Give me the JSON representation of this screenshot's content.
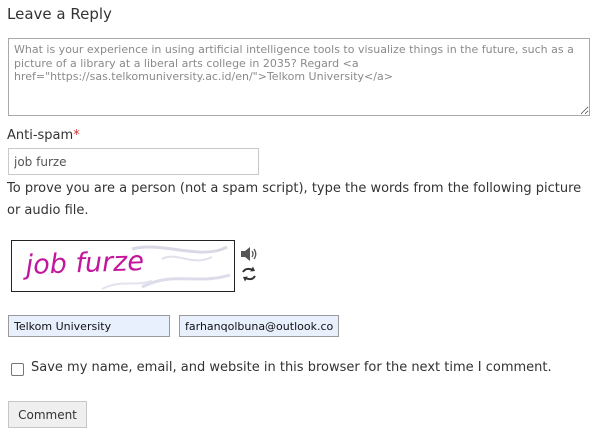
{
  "reply": {
    "title": "Leave a Reply"
  },
  "comment": {
    "placeholder": "What is your experience in using artificial intelligence tools to visualize things in the future, such as a picture of a library at a liberal arts college in 2035? Regard <a href=\"https://sas.telkomuniversity.ac.id/en/\">Telkom University</a>"
  },
  "antispam": {
    "label": "Anti-spam",
    "required_mark": "*",
    "value": "job furze",
    "instructions": "To prove you are a person (not a spam script), type the words from the following picture or audio file.",
    "captcha_text": "job furze",
    "captcha_color": "#c2179d",
    "audio_icon": "speaker-icon",
    "refresh_icon": "refresh-icon"
  },
  "author": {
    "name_value": "Telkom University",
    "email_value": "farhanqolbuna@outlook.co."
  },
  "autofill_color": "#e8f0fe",
  "consent": {
    "label": "Save my name, email, and website in this browser for the next time I comment.",
    "checked": false
  },
  "submit": {
    "label": "Comment"
  }
}
